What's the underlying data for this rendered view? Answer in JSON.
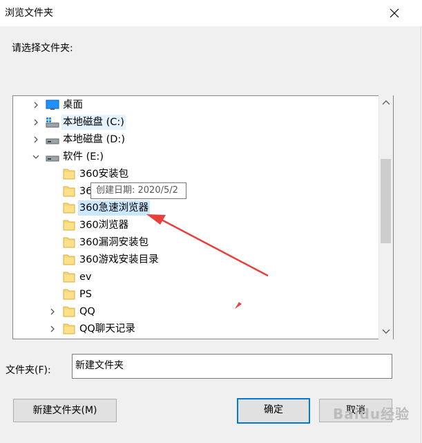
{
  "window": {
    "title": "浏览文件夹"
  },
  "prompt": "请选择文件夹:",
  "tree": {
    "items": [
      {
        "label": "桌面",
        "icon": "desktop-icon",
        "expandable": true,
        "expanded": false,
        "level": 1
      },
      {
        "label": "本地磁盘 (C:)",
        "icon": "windows-drive-icon",
        "expandable": true,
        "expanded": false,
        "level": 1,
        "state": "hover"
      },
      {
        "label": "本地磁盘 (D:)",
        "icon": "drive-icon",
        "expandable": true,
        "expanded": false,
        "level": 1
      },
      {
        "label": "软件 (E:)",
        "icon": "drive-icon",
        "expandable": true,
        "expanded": true,
        "level": 1
      },
      {
        "label": "360安装包",
        "icon": "folder-icon",
        "expandable": false,
        "level": 2
      },
      {
        "label": "36",
        "icon": "folder-icon",
        "expandable": false,
        "level": 2
      },
      {
        "label": "360急速浏览器",
        "icon": "folder-icon",
        "expandable": false,
        "level": 2,
        "state": "selected"
      },
      {
        "label": "360浏览器",
        "icon": "folder-icon",
        "expandable": false,
        "level": 2
      },
      {
        "label": "360漏洞安装包",
        "icon": "folder-icon",
        "expandable": false,
        "level": 2
      },
      {
        "label": "360游戏安装目录",
        "icon": "folder-icon",
        "expandable": false,
        "level": 2
      },
      {
        "label": "ev",
        "icon": "folder-icon",
        "expandable": false,
        "level": 2
      },
      {
        "label": "PS",
        "icon": "folder-icon",
        "expandable": false,
        "level": 2
      },
      {
        "label": "QQ",
        "icon": "folder-icon",
        "expandable": true,
        "expanded": false,
        "level": 2
      },
      {
        "label": "QQ聊天记录",
        "icon": "folder-icon",
        "expandable": true,
        "expanded": false,
        "level": 2
      }
    ],
    "tooltip": "创建日期: 2020/5/2"
  },
  "folder_field": {
    "label": "文件夹(F):",
    "value": "新建文件夹"
  },
  "buttons": {
    "new_folder": "新建文件夹(M)",
    "ok": "确定",
    "cancel": "取消"
  },
  "watermark": "Baidu经验",
  "colors": {
    "selection": "#cce8ff",
    "hover": "#e5f3ff",
    "accent": "#0078d7",
    "annotation_arrow": "#e8413c"
  }
}
